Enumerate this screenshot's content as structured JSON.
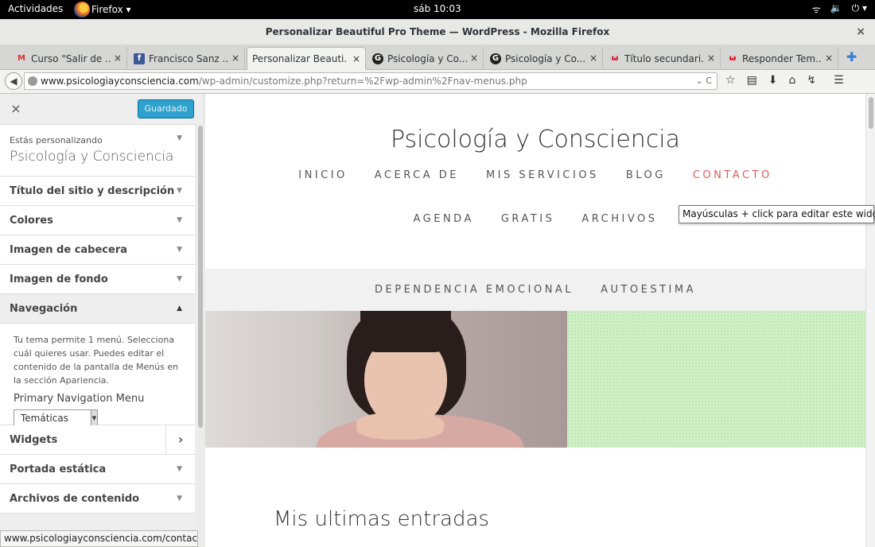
{
  "system": {
    "activities": "Actividades",
    "app": "Firefox",
    "app_arrow": "▾",
    "clock": "sáb 10:03",
    "wifi": "wifi-icon",
    "volume": "volume-icon",
    "power": "⏻ ▾"
  },
  "window": {
    "title": "Personalizar Beautiful Pro Theme — WordPress - Mozilla Firefox",
    "close": "×"
  },
  "tabs": [
    {
      "fav": "M",
      "favcolor": "#d93025",
      "label": "Curso \"Salir de ...",
      "close": "×"
    },
    {
      "fav": "f",
      "favcolor": "#3b5998",
      "label": "Francisco Sanz ...",
      "close": "×"
    },
    {
      "fav": "",
      "favcolor": "",
      "label": "Personalizar Beauti...",
      "close": "×"
    },
    {
      "fav": "G",
      "favcolor": "#222222",
      "label": "Psicología y Co...",
      "close": "×"
    },
    {
      "fav": "G",
      "favcolor": "#222222",
      "label": "Psicología y Co...",
      "close": "×"
    },
    {
      "fav": "ω",
      "favcolor": "#d9001b",
      "label": "Título secundari...",
      "close": "×"
    },
    {
      "fav": "ω",
      "favcolor": "#d9001b",
      "label": "Responder Tem...",
      "close": "×"
    }
  ],
  "new_tab": "✚",
  "url": {
    "domain": "www.psicologiayconsciencia.com",
    "path": "/wp-admin/customize.php?return=%2Fwp-admin%2Fnav-menus.php",
    "right": "⌄ C"
  },
  "sidebar": {
    "close": "×",
    "saved": "Guardado",
    "customizing_label": "Estás personalizando",
    "site_name": "Psicología y Consciencia",
    "sections": [
      "Título del sitio y descripción corta",
      "Colores",
      "Imagen de cabecera",
      "Imagen de fondo"
    ],
    "nav": {
      "title": "Navegación",
      "desc": "Tu tema permite 1 menú. Selecciona cuál quieres usar. Puedes editar el contenido de la pantalla de Menús en la sección Apariencia.",
      "menu_label": "Primary Navigation Menu",
      "menu_value": "Temáticas"
    },
    "widgets": "Widgets",
    "after": [
      "Portada estática",
      "Archivos de contenido"
    ]
  },
  "statusbar": "www.psicologiayconsciencia.com/contacto/",
  "preview": {
    "title": "Psicología y Consciencia",
    "menu1": [
      "INICIO",
      "ACERCA DE",
      "MIS SERVICIOS",
      "BLOG",
      "CONTACTO"
    ],
    "menu2": [
      "AGENDA",
      "GRATIS",
      "ARCHIVOS"
    ],
    "band": [
      "DEPENDENCIA EMOCIONAL",
      "AUTOESTIMA"
    ],
    "tooltip": "Mayúsculas + click para editar este widget.",
    "entries_heading": "Mis ultimas entradas"
  }
}
